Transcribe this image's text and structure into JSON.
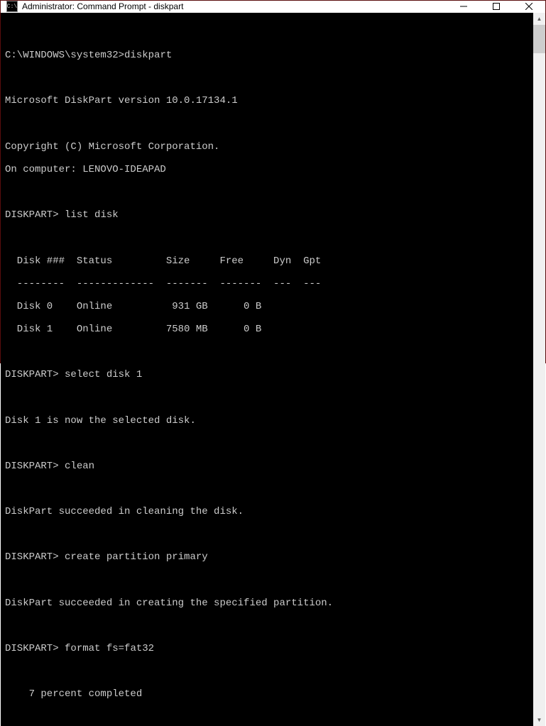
{
  "window": {
    "title": "Administrator: Command Prompt - diskpart",
    "icon_label": "C:\\"
  },
  "prompt_initial": "C:\\WINDOWS\\system32>",
  "cmd_initial": "diskpart",
  "version_line": "Microsoft DiskPart version 10.0.17134.1",
  "copyright_line": "Copyright (C) Microsoft Corporation.",
  "computer_line": "On computer: LENOVO-IDEAPAD",
  "dp_prompt": "DISKPART>",
  "cmds": {
    "list_disk": "list disk",
    "select_disk": "select disk 1",
    "clean": "clean",
    "create_part": "create partition primary",
    "format": "format fs=fat32"
  },
  "table": {
    "header": "  Disk ###  Status         Size     Free     Dyn  Gpt",
    "divider": "  --------  -------------  -------  -------  ---  ---",
    "rows": [
      "  Disk 0    Online          931 GB      0 B",
      "  Disk 1    Online         7580 MB      0 B"
    ]
  },
  "msgs": {
    "selected": "Disk 1 is now the selected disk.",
    "cleaned": "DiskPart succeeded in cleaning the disk.",
    "created": "DiskPart succeeded in creating the specified partition.",
    "progress": "    7 percent completed"
  }
}
